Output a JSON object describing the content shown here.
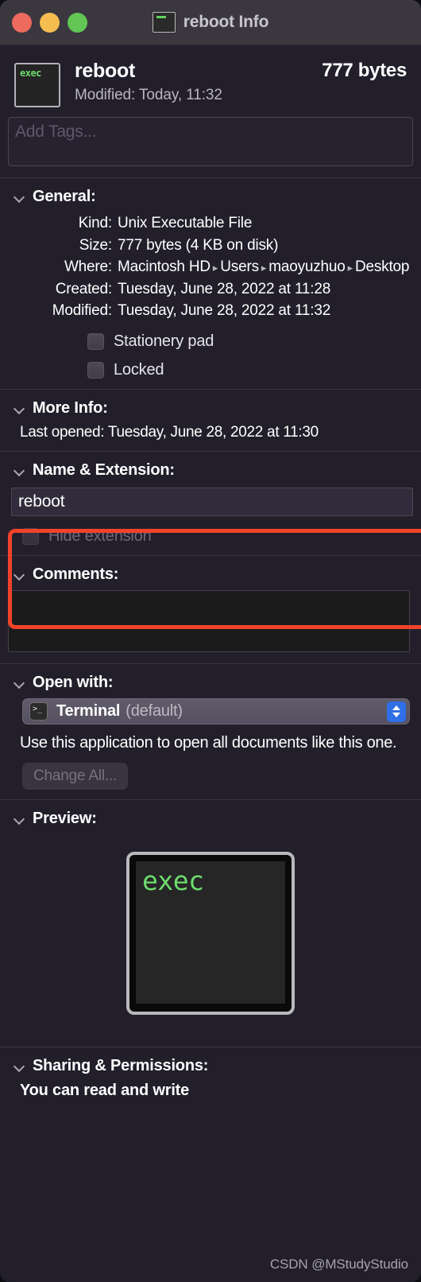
{
  "window": {
    "title": "reboot Info",
    "title_icon": "terminal-file-icon",
    "traffic_lights": [
      "close-button",
      "minimize-button",
      "zoom-button"
    ]
  },
  "header": {
    "icon": "exec-file-icon",
    "icon_text": "exec",
    "name": "reboot",
    "modified": "Modified: Today, 11:32",
    "size": "777 bytes"
  },
  "tags": {
    "placeholder": "Add Tags..."
  },
  "general": {
    "title": "General:",
    "rows": [
      {
        "label": "Kind:",
        "value": "Unix Executable File"
      },
      {
        "label": "Size:",
        "value": "777 bytes (4 KB on disk)"
      },
      {
        "label": "Where:",
        "value": "Macintosh HD ▸ Users ▸ maoyuzhuo ▸ Desktop"
      },
      {
        "label": "Created:",
        "value": "Tuesday, June 28, 2022 at 11:28"
      },
      {
        "label": "Modified:",
        "value": "Tuesday, June 28, 2022 at 11:32"
      }
    ],
    "where_parts": [
      "Macintosh HD",
      "Users",
      "maoyuzhuo",
      "Desktop"
    ],
    "checkboxes": [
      {
        "label": "Stationery pad",
        "checked": false
      },
      {
        "label": "Locked",
        "checked": false
      }
    ]
  },
  "more_info": {
    "title": "More Info:",
    "last_opened_label": "Last opened:",
    "last_opened_value": "Tuesday, June 28, 2022 at 11:30"
  },
  "name_extension": {
    "title": "Name & Extension:",
    "value": "reboot",
    "hide_extension_label": "Hide extension",
    "hide_extension_checked": false,
    "highlight_color": "#f0432a"
  },
  "comments": {
    "title": "Comments:",
    "value": ""
  },
  "open_with": {
    "title": "Open with:",
    "app_icon": "terminal-app-icon",
    "app_name": "Terminal",
    "app_default_suffix": "(default)",
    "description": "Use this application to open all documents like this one.",
    "change_all_label": "Change All..."
  },
  "preview": {
    "title": "Preview:",
    "icon_text": "exec"
  },
  "sharing": {
    "title": "Sharing & Permissions:",
    "summary": "You can read and write"
  },
  "watermark": "CSDN @MStudyStudio"
}
